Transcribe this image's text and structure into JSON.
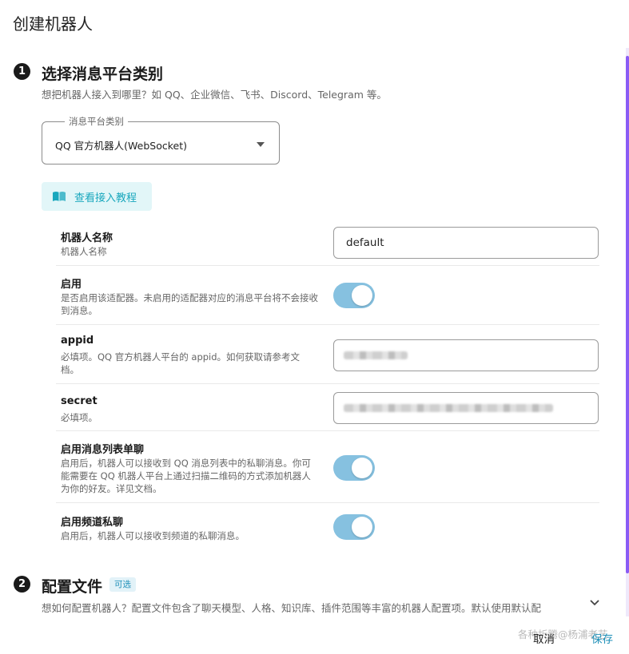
{
  "dialog": {
    "title": "创建机器人"
  },
  "step1": {
    "number": "1",
    "title": "选择消息平台类别",
    "description": "想把机器人接入到哪里？如 QQ、企业微信、飞书、Discord、Telegram 等。",
    "select": {
      "legend": "消息平台类别",
      "value": "QQ 官方机器人(WebSocket)"
    },
    "tutorial_button": {
      "label": "查看接入教程",
      "icon": "book-icon"
    }
  },
  "fields": [
    {
      "label": "机器人名称",
      "help": "机器人名称",
      "type": "text",
      "value": "default"
    },
    {
      "label": "启用",
      "help": "是否启用该适配器。未启用的适配器对应的消息平台将不会接收到消息。",
      "type": "toggle",
      "enabled": true
    },
    {
      "label": "appid",
      "help": "必填项。QQ 官方机器人平台的 appid。如何获取请参考文档。",
      "type": "text",
      "redacted": true
    },
    {
      "label": "secret",
      "help": "必填项。",
      "type": "text",
      "redacted": true
    },
    {
      "label": "启用消息列表单聊",
      "help": "启用后，机器人可以接收到 QQ 消息列表中的私聊消息。你可能需要在 QQ 机器人平台上通过扫描二维码的方式添加机器人为你的好友。详见文档。",
      "type": "toggle",
      "enabled": true
    },
    {
      "label": "启用频道私聊",
      "help": "启用后，机器人可以接收到频道的私聊消息。",
      "type": "toggle",
      "enabled": true
    }
  ],
  "step2": {
    "number": "2",
    "title": "配置文件",
    "badge": "可选",
    "description": "想如何配置机器人？配置文件包含了聊天模型、人格、知识库、插件范围等丰富的机器人配置项。默认使用默认配"
  },
  "footer": {
    "cancel_label": "取消",
    "save_label": "保存",
    "watermark": "各种折腾@杨浦老艺"
  },
  "colors": {
    "accent": "#1e8fb8",
    "toggle_on": "#86c1e0",
    "tutorial_bg": "#e2f6f8",
    "scrollbar": "#8a5cf5"
  }
}
